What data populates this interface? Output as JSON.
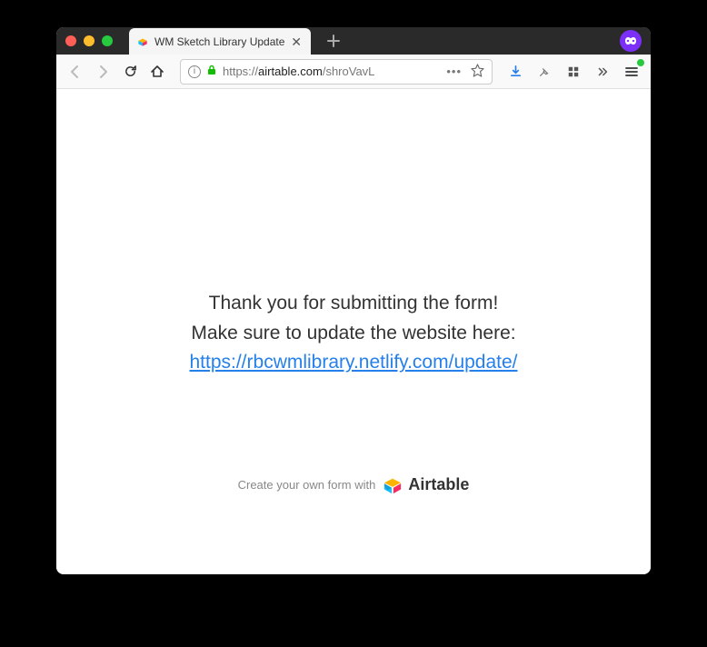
{
  "tab": {
    "title": "WM Sketch Library Update"
  },
  "urlbar": {
    "prefix": "https://",
    "domain": "airtable.com",
    "path": "/shroVavL"
  },
  "page": {
    "line1": "Thank you for submitting the form!",
    "line2": "Make sure to update the website here:",
    "link": "https://rbcwmlibrary.netlify.com/update/"
  },
  "footer": {
    "text": "Create your own form with",
    "brand": "Airtable"
  }
}
